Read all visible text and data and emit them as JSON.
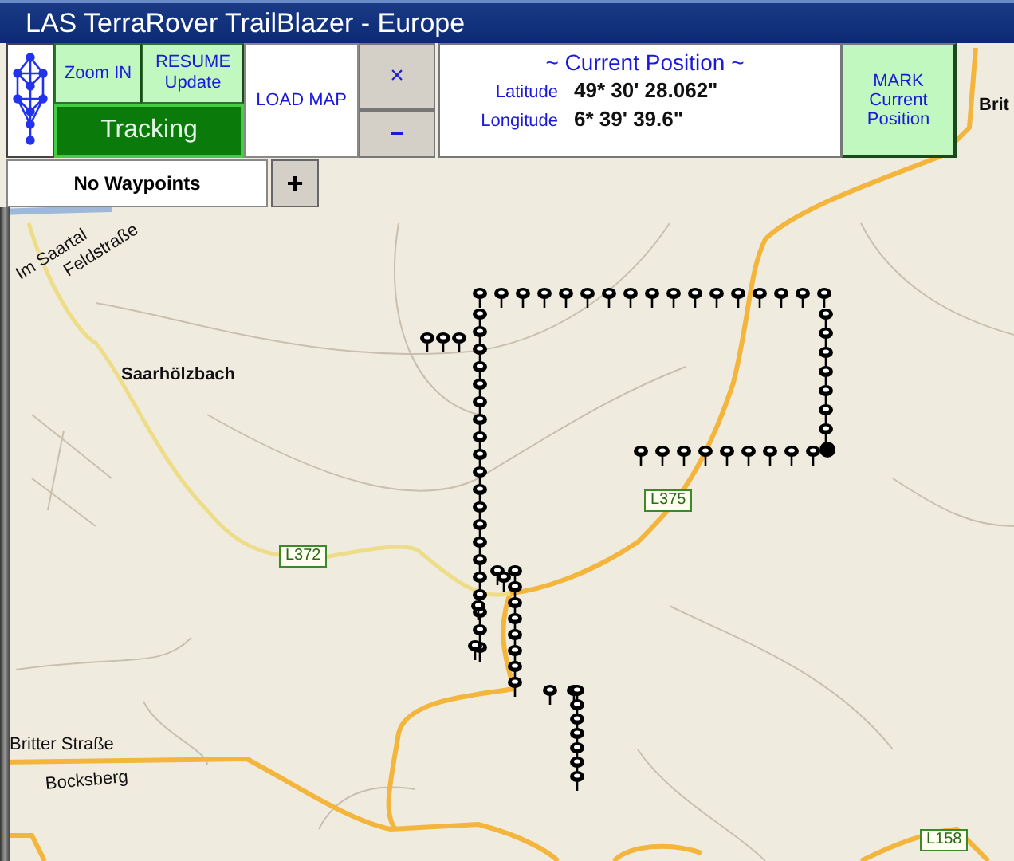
{
  "window": {
    "title": "LAS TerraRover TrailBlazer - Europe"
  },
  "toolbar": {
    "zoom_in": "Zoom IN",
    "resume": "RESUME Update",
    "tracking": {
      "label": "Tracking",
      "on": true
    },
    "load_map": "LOAD MAP",
    "close": "×",
    "minimize": "–"
  },
  "position": {
    "heading": "~ Current Position ~",
    "latitude_label": "Latitude",
    "latitude": "49* 30' 28.062\"",
    "longitude_label": "Longitude",
    "longitude": "6* 39' 39.6\""
  },
  "mark_button": "MARK Current Position",
  "waypoints": {
    "value": "No Waypoints",
    "add": "+"
  },
  "map": {
    "labels": [
      {
        "text": "Brit",
        "kind": "town"
      },
      {
        "text": "Im Saartal",
        "kind": "street"
      },
      {
        "text": "Feldstraße",
        "kind": "street"
      },
      {
        "text": "Saarhölzbach",
        "kind": "town"
      },
      {
        "text": "L375",
        "kind": "sign"
      },
      {
        "text": "L372",
        "kind": "sign"
      },
      {
        "text": "Britter Straße",
        "kind": "street"
      },
      {
        "text": "Bocksberg",
        "kind": "street"
      },
      {
        "text": "L158",
        "kind": "sign"
      }
    ]
  }
}
